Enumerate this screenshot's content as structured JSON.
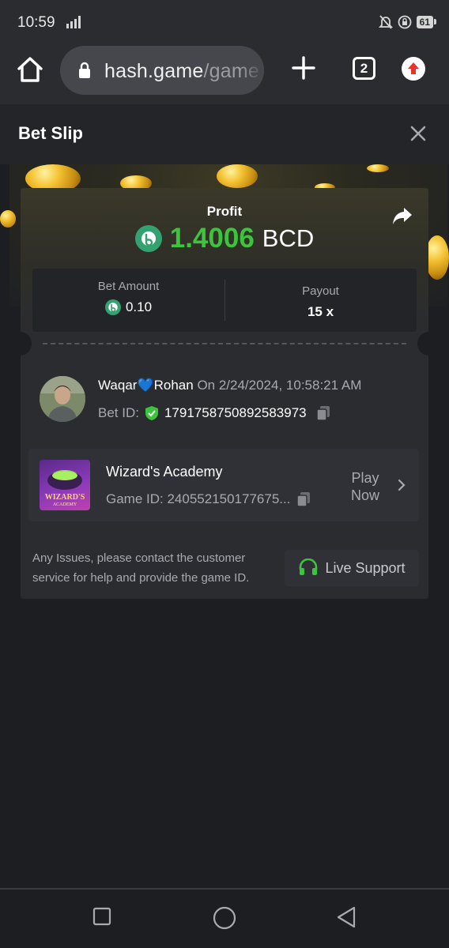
{
  "status_bar": {
    "time": "10:59",
    "battery": "61"
  },
  "browser": {
    "url_host": "hash.game",
    "url_path": "/game",
    "tab_count": "2"
  },
  "header": {
    "title": "Bet Slip"
  },
  "profit": {
    "label": "Profit",
    "value": "1.4006",
    "currency": "BCD",
    "value_color": "#3cc43c"
  },
  "stats": {
    "bet_amount_label": "Bet Amount",
    "bet_amount_value": "0.10",
    "payout_label": "Payout",
    "payout_value": "15 x"
  },
  "user": {
    "name": "Waqar💙Rohan",
    "date": "On 2/24/2024, 10:58:21 AM",
    "bet_id_label": "Bet ID:",
    "bet_id": "1791758750892583973"
  },
  "game": {
    "name": "Wizard's Academy",
    "game_id": "Game ID: 240552150177675...",
    "play_now_line1": "Play",
    "play_now_line2": "Now",
    "thumb_title": "WIZARD'S",
    "thumb_subtitle": "ACADEMY"
  },
  "support": {
    "help_text": "Any Issues, please contact the customer service for help and provide the game ID.",
    "live_support_label": "Live Support",
    "accent": "#3cc43c"
  },
  "icons": [
    "home-icon",
    "lock-icon",
    "plus-icon",
    "tabs-icon",
    "update-icon",
    "close-icon",
    "share-icon",
    "bcd-coin-icon",
    "verified-shield-icon",
    "copy-icon",
    "chevron-right-icon",
    "headset-icon",
    "square-icon",
    "circle-icon",
    "back-triangle-icon"
  ]
}
